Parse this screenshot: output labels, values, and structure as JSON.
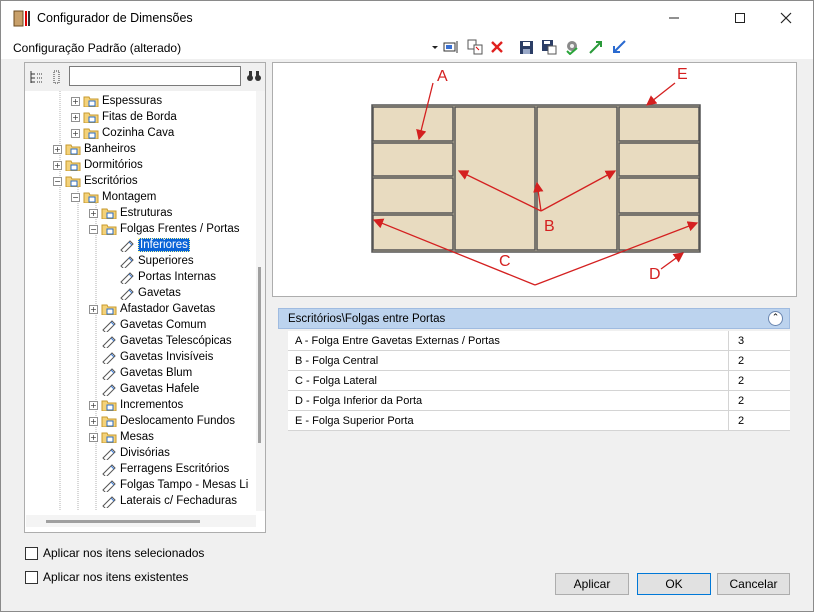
{
  "window": {
    "title": "Configurador de Dimensões",
    "minimize_icon": "minimize-icon",
    "maximize_icon": "maximize-icon",
    "close_icon": "close-icon"
  },
  "toolbar": {
    "config_label": "Configuração Padrão (alterado)",
    "icons": [
      "dropdown-arrow-icon",
      "rename-icon",
      "copy-config-icon",
      "delete-icon",
      "save-icon",
      "save-as-icon",
      "settings-check-icon",
      "export-icon",
      "import-icon"
    ]
  },
  "tree_toolbar": {
    "icons": [
      "expand-all-icon",
      "collapse-all-icon",
      "binoculars-icon"
    ],
    "search_value": ""
  },
  "tree": [
    {
      "label": "Espessuras",
      "type": "folder",
      "expand": "+"
    },
    {
      "label": "Fitas de Borda",
      "type": "folder",
      "expand": "+"
    },
    {
      "label": "Cozinha Cava",
      "type": "folder",
      "expand": "+"
    },
    {
      "label": "Banheiros",
      "type": "folder",
      "expand": "+"
    },
    {
      "label": "Dormitórios",
      "type": "folder",
      "expand": "+"
    },
    {
      "label": "Escritórios",
      "type": "folder",
      "expand": "−"
    },
    {
      "label": "Montagem",
      "type": "folder",
      "expand": "−"
    },
    {
      "label": "Estruturas",
      "type": "folder",
      "expand": "+"
    },
    {
      "label": "Folgas Frentes / Portas",
      "type": "folder",
      "expand": "−"
    },
    {
      "label": "Inferiores",
      "type": "leaf",
      "selected": true
    },
    {
      "label": "Superiores",
      "type": "leaf"
    },
    {
      "label": "Portas Internas",
      "type": "leaf"
    },
    {
      "label": "Gavetas",
      "type": "leaf"
    },
    {
      "label": "Afastador Gavetas",
      "type": "folder",
      "expand": "+"
    },
    {
      "label": "Gavetas Comum",
      "type": "leaf"
    },
    {
      "label": "Gavetas Telescópicas",
      "type": "leaf"
    },
    {
      "label": "Gavetas Invisíveis",
      "type": "leaf"
    },
    {
      "label": "Gavetas Blum",
      "type": "leaf"
    },
    {
      "label": "Gavetas Hafele",
      "type": "leaf"
    },
    {
      "label": "Incrementos",
      "type": "folder",
      "expand": "+"
    },
    {
      "label": "Deslocamento Fundos",
      "type": "folder",
      "expand": "+"
    },
    {
      "label": "Mesas",
      "type": "folder",
      "expand": "+"
    },
    {
      "label": "Divisórias",
      "type": "leaf"
    },
    {
      "label": "Ferragens Escritórios",
      "type": "leaf"
    },
    {
      "label": "Folgas Tampo - Mesas Li",
      "type": "leaf"
    },
    {
      "label": "Laterais c/ Fechaduras",
      "type": "leaf"
    }
  ],
  "diagram": {
    "labels": [
      "A",
      "B",
      "C",
      "D",
      "E"
    ]
  },
  "properties": {
    "header": "Escritórios\\Folgas entre Portas",
    "collapse_icon": "double-chevron-up-icon",
    "rows": [
      {
        "label": "A - Folga Entre Gavetas Externas / Portas",
        "value": "3"
      },
      {
        "label": "B - Folga Central",
        "value": "2"
      },
      {
        "label": "C - Folga Lateral",
        "value": "2"
      },
      {
        "label": "D - Folga Inferior da Porta",
        "value": "2"
      },
      {
        "label": "E - Folga Superior Porta",
        "value": "2"
      }
    ]
  },
  "options": {
    "apply_selected": "Aplicar nos itens selecionados",
    "apply_existing": "Aplicar nos itens existentes"
  },
  "buttons": {
    "apply": "Aplicar",
    "ok": "OK",
    "cancel": "Cancelar"
  },
  "colors": {
    "selection": "#0a64d8",
    "header_bg": "#bcd3ee",
    "arrow": "#d42020",
    "wood": "#e6d8bb"
  }
}
